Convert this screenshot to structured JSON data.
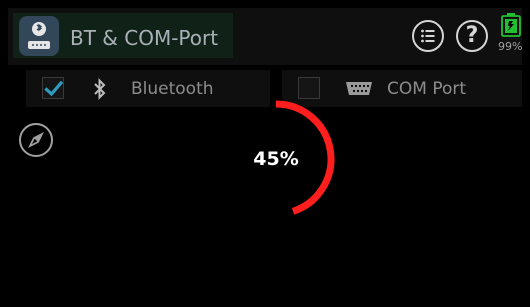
{
  "header": {
    "title": "BT & COM-Port",
    "battery_percent": "99%",
    "battery_color": "#22c030"
  },
  "tabs": [
    {
      "label": "Bluetooth",
      "checked": true,
      "icon": "bluetooth-icon"
    },
    {
      "label": "COM Port",
      "checked": false,
      "icon": "serial-port-icon"
    }
  ],
  "progress": {
    "value": 0.45,
    "label": "45%",
    "color": "#ff1e1e"
  },
  "colors": {
    "accent_check": "#2e9bbf",
    "background": "#000000"
  }
}
